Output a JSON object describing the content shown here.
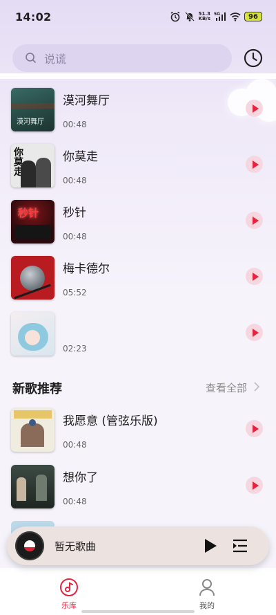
{
  "status_bar": {
    "time": "14:02",
    "net_speed_value": "51.3",
    "net_speed_unit": "KB/s",
    "signal_label": "5G",
    "battery": "96"
  },
  "search": {
    "placeholder": "说谎"
  },
  "songs": [
    {
      "title": "漠河舞厅",
      "duration": "00:48",
      "cover_text": "漠河舞厅"
    },
    {
      "title": "你莫走",
      "duration": "00:48",
      "cover_text": "你莫走"
    },
    {
      "title": "秒针",
      "duration": "00:48",
      "cover_text": "秒针"
    },
    {
      "title": "梅卡德尔",
      "duration": "05:52",
      "cover_text": ""
    },
    {
      "title": "",
      "duration": "02:23",
      "cover_text": ""
    }
  ],
  "section": {
    "title": "新歌推荐",
    "more": "查看全部"
  },
  "new_songs": [
    {
      "title": "我愿意 (管弦乐版)",
      "duration": "00:48"
    },
    {
      "title": "想你了",
      "duration": "00:48"
    }
  ],
  "player": {
    "title": "暂无歌曲"
  },
  "nav": {
    "tabs": [
      {
        "label": "乐库",
        "active": true
      },
      {
        "label": "我的",
        "active": false
      }
    ]
  },
  "colors": {
    "accent": "#e4233f",
    "play_bg": "#f6d7e0",
    "search_bg": "#ddd5f0"
  }
}
